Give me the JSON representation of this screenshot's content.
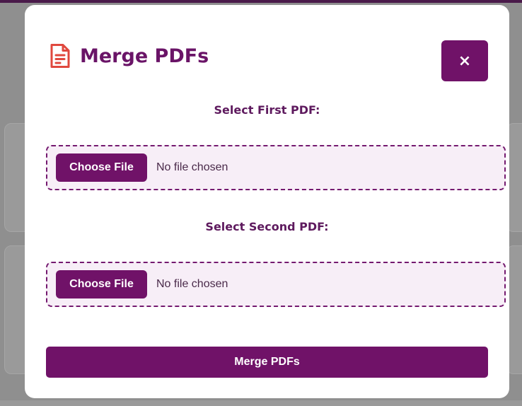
{
  "modal": {
    "title": "Merge PDFs",
    "title_icon": "document-icon",
    "close_label": "×"
  },
  "first_pdf": {
    "label": "Select First PDF:",
    "button_label": "Choose File",
    "status": "No file chosen"
  },
  "second_pdf": {
    "label": "Select Second PDF:",
    "button_label": "Choose File",
    "status": "No file chosen"
  },
  "actions": {
    "merge_label": "Merge PDFs"
  },
  "colors": {
    "primary": "#701268",
    "title": "#6a1467",
    "icon": "#e0483e",
    "drop_zone_bg": "#f7eef7",
    "overlay": "#8f8f8f"
  }
}
